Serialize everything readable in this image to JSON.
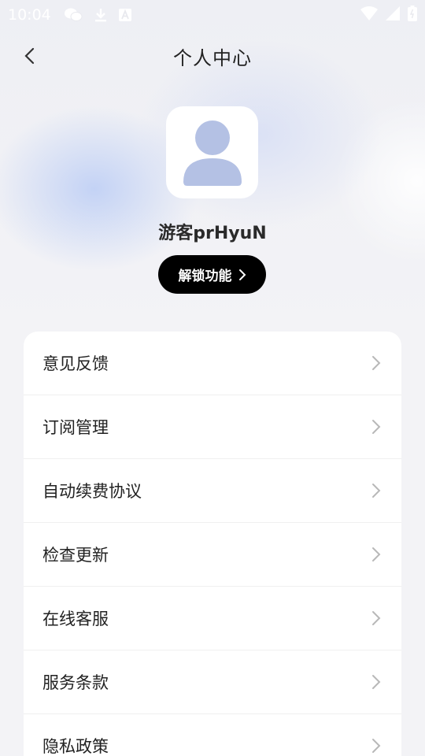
{
  "status_bar": {
    "time": "10:04"
  },
  "header": {
    "title": "个人中心"
  },
  "profile": {
    "username": "游客prHyuN",
    "unlock_label": "解锁功能"
  },
  "menu": [
    {
      "label": "意见反馈"
    },
    {
      "label": "订阅管理"
    },
    {
      "label": "自动续费协议"
    },
    {
      "label": "检查更新"
    },
    {
      "label": "在线客服"
    },
    {
      "label": "服务条款"
    },
    {
      "label": "隐私政策"
    }
  ],
  "colors": {
    "accent": "#000000",
    "avatar": "#b4c1e4",
    "background": "#f3f3f6"
  }
}
